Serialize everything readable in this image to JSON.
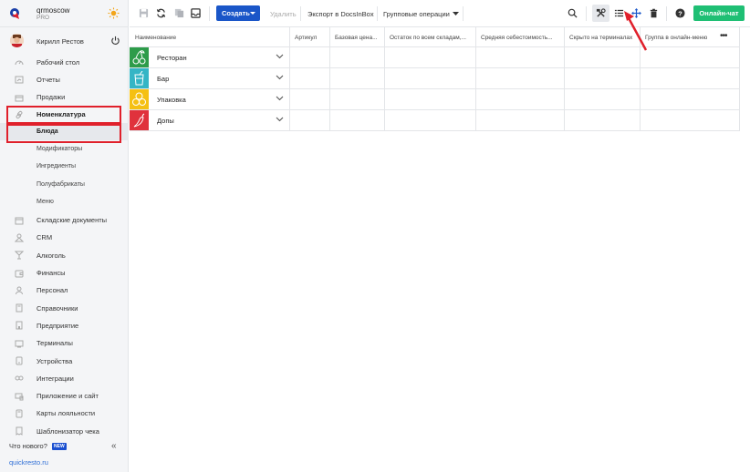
{
  "brand": {
    "name": "qrmoscow",
    "plan": "PRO"
  },
  "user": {
    "name": "Кирилл Рестов"
  },
  "colors": {
    "accent": "#1a56c8",
    "chat": "#1fbf74",
    "highlight": "#e0202b"
  },
  "nav": [
    {
      "label": "Рабочий стол",
      "icon": "dashboard-icon"
    },
    {
      "label": "Отчеты",
      "icon": "reports-icon"
    },
    {
      "label": "Продажи",
      "icon": "sales-icon"
    },
    {
      "label": "Номенклатура",
      "icon": "link-icon"
    },
    {
      "label": "Блюда",
      "sub": true
    },
    {
      "label": "Модификаторы",
      "sub": true
    },
    {
      "label": "Ингредиенты",
      "sub": true
    },
    {
      "label": "Полуфабрикаты",
      "sub": true
    },
    {
      "label": "Меню",
      "sub": true
    },
    {
      "label": "Складские документы",
      "icon": "warehouse-icon"
    },
    {
      "label": "CRM",
      "icon": "crm-icon"
    },
    {
      "label": "Алкоголь",
      "icon": "glass-icon"
    },
    {
      "label": "Финансы",
      "icon": "wallet-icon"
    },
    {
      "label": "Персонал",
      "icon": "staff-icon"
    },
    {
      "label": "Справочники",
      "icon": "book-icon"
    },
    {
      "label": "Предприятие",
      "icon": "building-icon"
    },
    {
      "label": "Терминалы",
      "icon": "terminal-icon"
    },
    {
      "label": "Устройства",
      "icon": "device-icon"
    },
    {
      "label": "Интеграции",
      "icon": "integration-icon"
    },
    {
      "label": "Приложение и сайт",
      "icon": "app-icon"
    },
    {
      "label": "Карты лояльности",
      "icon": "card-icon"
    },
    {
      "label": "Шаблонизатор чека",
      "icon": "receipt-icon"
    }
  ],
  "whats_new": {
    "label": "Что нового?",
    "badge": "NEW"
  },
  "footer": {
    "link": "quickresto.ru"
  },
  "toolbar": {
    "create": "Создать",
    "delete": "Удалить",
    "export": "Экспорт в DocsInBox",
    "group_ops": "Групповые операции",
    "chat": "Онлайн-чат"
  },
  "table": {
    "columns": [
      "Наименование",
      "Артикул",
      "Базовая цена...",
      "Остаток по всем складам,...",
      "Средняя себестоимость...",
      "Скрыто на терминалах",
      "Группа в онлайн-меню"
    ],
    "more": "•••",
    "rows": [
      {
        "name": "Ресторан",
        "color": "#2e9c4a",
        "icon": "cherries-icon"
      },
      {
        "name": "Бар",
        "color": "#35b5c5",
        "icon": "cocktail-icon"
      },
      {
        "name": "Упаковка",
        "color": "#f5c013",
        "icon": "bubbles-icon"
      },
      {
        "name": "Допы",
        "color": "#e0323c",
        "icon": "pepper-icon"
      }
    ]
  }
}
